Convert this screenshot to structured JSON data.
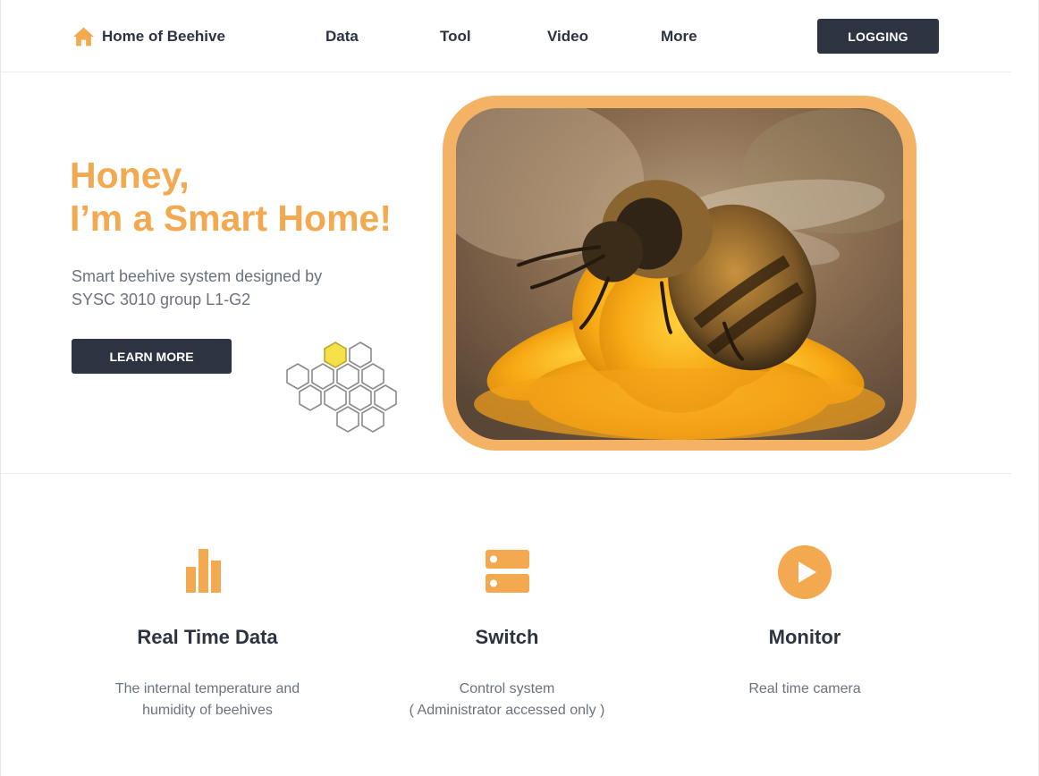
{
  "header": {
    "brand": "Home of Beehive",
    "nav": [
      "Data",
      "Tool",
      "Video",
      "More"
    ],
    "login_label": "LOGGING"
  },
  "hero": {
    "title_line1": "Honey,",
    "title_line2": "I’m a Smart Home!",
    "subtitle_line1": "Smart beehive system designed by",
    "subtitle_line2": "SYSC 3010 group L1-G2",
    "cta_label": "LEARN MORE"
  },
  "features": [
    {
      "icon": "bar-chart-icon",
      "title": "Real Time Data",
      "desc_line1": "The internal temperature and",
      "desc_line2": "humidity of beehives"
    },
    {
      "icon": "server-icon",
      "title": "Switch",
      "desc_line1": "Control system",
      "desc_line2": "( Administrator accessed only )"
    },
    {
      "icon": "play-icon",
      "title": "Monitor",
      "desc_line1": "Real time camera",
      "desc_line2": ""
    }
  ],
  "colors": {
    "accent": "#f2a94f",
    "dark": "#2d3340",
    "muted": "#6b7280"
  }
}
